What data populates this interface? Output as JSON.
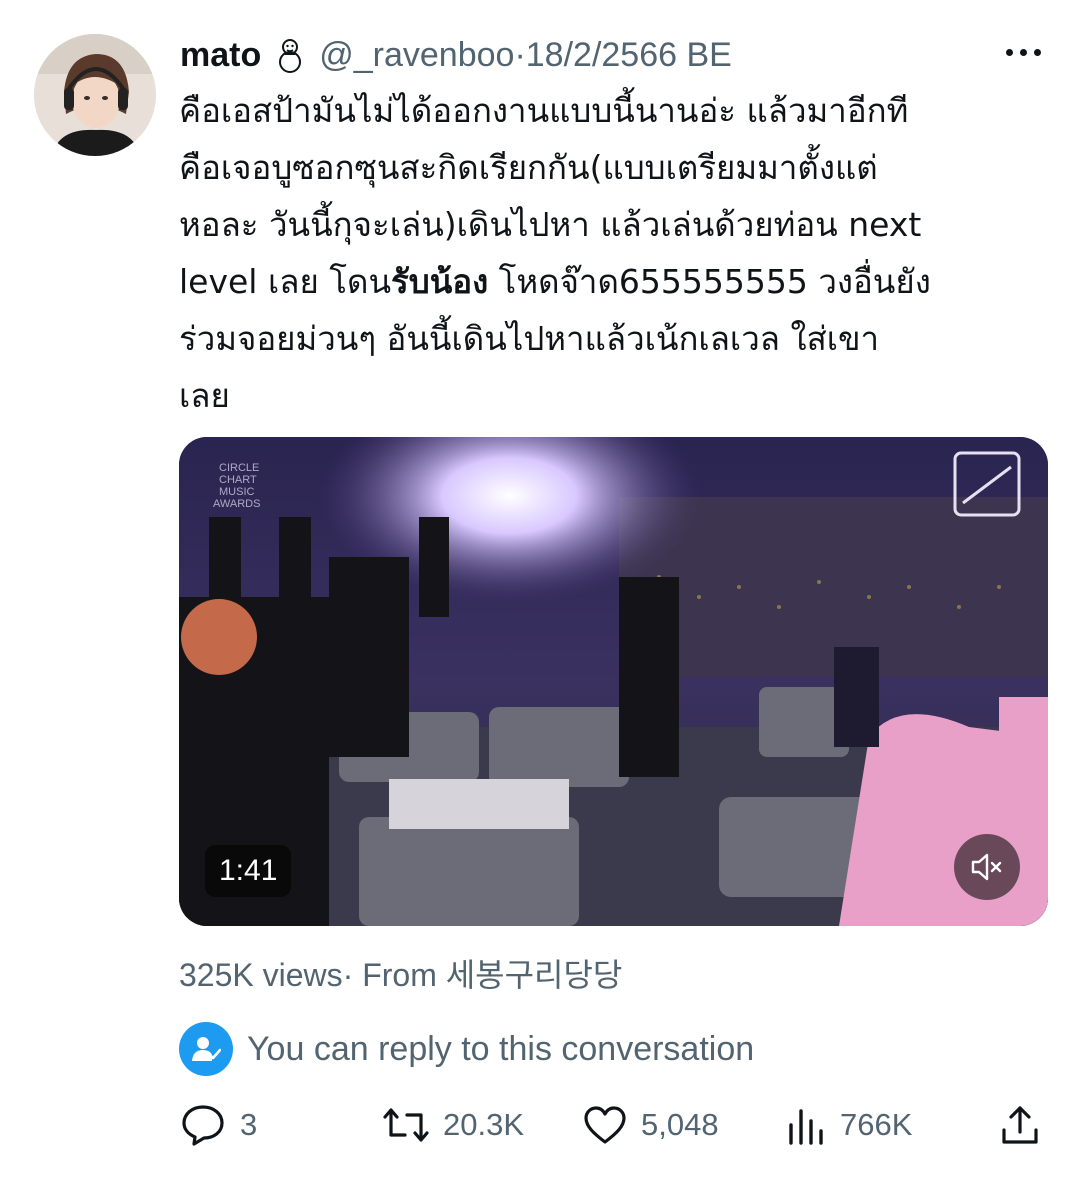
{
  "tweet": {
    "display_name": "mato",
    "name_emoji": "snowman-icon",
    "handle": "@_ravenboo",
    "separator": "·",
    "date": "18/2/2566 BE",
    "text_lines": [
      {
        "parts": [
          {
            "text": "คือเอสป้ามันไม่ได้ออกงานแบบนี้นานอ่ะ แล้วมาอีกที",
            "bold": false
          }
        ]
      },
      {
        "parts": [
          {
            "text": "คือเจอบูซอกซุนสะกิดเรียกกัน(แบบเตรียมมาตั้งแต่",
            "bold": false
          }
        ]
      },
      {
        "parts": [
          {
            "text": "หอละ วันนี้กุจะเล่น)เดินไปหา แล้วเล่นด้วยท่อน next",
            "bold": false
          }
        ]
      },
      {
        "parts": [
          {
            "text": "level เลย โดน",
            "bold": false
          },
          {
            "text": "รับน้อง",
            "bold": true
          },
          {
            "text": " โหดจ๊าด655555555 วงอื่นยัง",
            "bold": false
          }
        ]
      },
      {
        "parts": [
          {
            "text": "ร่วมจอยม่วนๆ อันนี้เดินไปหาแล้วเน้กเลเวล ใส่เขา",
            "bold": false
          }
        ]
      },
      {
        "parts": [
          {
            "text": "เลย",
            "bold": false
          }
        ]
      }
    ]
  },
  "media": {
    "watermark_left": [
      "CIRCLE",
      "CHART",
      "MUSIC",
      "AWARDS"
    ],
    "duration": "1:41",
    "mute_icon": "speaker-muted-icon"
  },
  "stats": {
    "views": "325K views",
    "from_prefix": "· From ",
    "from_name": "세봉구리당당"
  },
  "reply_notice": "You can reply to this conversation",
  "actions": {
    "replies": "3",
    "retweets": "20.3K",
    "likes": "5,048",
    "views": "766K"
  },
  "colors": {
    "text": "#0f1419",
    "secondary": "#536471",
    "accent": "#1d9bf0"
  }
}
